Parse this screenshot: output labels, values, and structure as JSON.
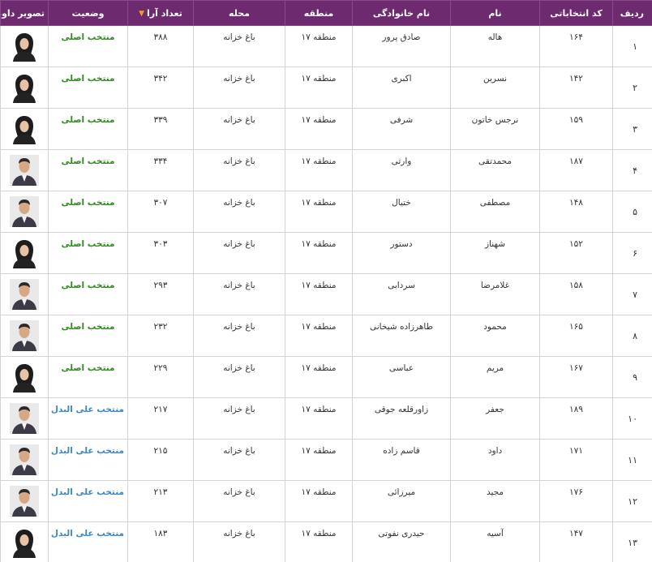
{
  "headers": {
    "row": "ردیف",
    "code": "کد انتخاباتی",
    "first_name": "نام",
    "last_name": "نام خانوادگی",
    "region": "منطقه",
    "area": "محله",
    "votes": "تعداد آرا",
    "status": "وضعیت",
    "photo": "تصویر داوطلب"
  },
  "status_colors": {
    "main": "#2e8b1e",
    "alternate": "#3a88c8"
  },
  "header_color": "#6e2a6e",
  "rows": [
    {
      "row": "۱",
      "code": "۱۶۴",
      "first_name": "هاله",
      "last_name": "صادق پرور",
      "region": "منطقه ۱۷",
      "area": "باغ خزانه",
      "votes": "۳۸۸",
      "status": "منتخب اصلی",
      "kind": "main",
      "photo_icon": "female-avatar-icon"
    },
    {
      "row": "۲",
      "code": "۱۴۲",
      "first_name": "نسرین",
      "last_name": "اکبری",
      "region": "منطقه ۱۷",
      "area": "باغ خزانه",
      "votes": "۳۴۲",
      "status": "منتخب اصلی",
      "kind": "main",
      "photo_icon": "female-avatar-icon"
    },
    {
      "row": "۳",
      "code": "۱۵۹",
      "first_name": "نرجس خاتون",
      "last_name": "شرفی",
      "region": "منطقه ۱۷",
      "area": "باغ خزانه",
      "votes": "۳۳۹",
      "status": "منتخب اصلی",
      "kind": "main",
      "photo_icon": "female-avatar-icon"
    },
    {
      "row": "۴",
      "code": "۱۸۷",
      "first_name": "محمدتقی",
      "last_name": "وارثی",
      "region": "منطقه ۱۷",
      "area": "باغ خزانه",
      "votes": "۳۳۴",
      "status": "منتخب اصلی",
      "kind": "main",
      "photo_icon": "male-avatar-icon"
    },
    {
      "row": "۵",
      "code": "۱۴۸",
      "first_name": "مصطفی",
      "last_name": "ختیال",
      "region": "منطقه ۱۷",
      "area": "باغ خزانه",
      "votes": "۳۰۷",
      "status": "منتخب اصلی",
      "kind": "main",
      "photo_icon": "male-avatar-icon"
    },
    {
      "row": "۶",
      "code": "۱۵۲",
      "first_name": "شهناز",
      "last_name": "دستور",
      "region": "منطقه ۱۷",
      "area": "باغ خزانه",
      "votes": "۳۰۳",
      "status": "منتخب اصلی",
      "kind": "main",
      "photo_icon": "female-avatar-icon"
    },
    {
      "row": "۷",
      "code": "۱۵۸",
      "first_name": "غلامرضا",
      "last_name": "سردابی",
      "region": "منطقه ۱۷",
      "area": "باغ خزانه",
      "votes": "۲۹۳",
      "status": "منتخب اصلی",
      "kind": "main",
      "photo_icon": "male-avatar-icon"
    },
    {
      "row": "۸",
      "code": "۱۶۵",
      "first_name": "محمود",
      "last_name": "طاهرزاده شیخانی",
      "region": "منطقه ۱۷",
      "area": "باغ خزانه",
      "votes": "۲۳۲",
      "status": "منتخب اصلی",
      "kind": "main",
      "photo_icon": "male-avatar-icon"
    },
    {
      "row": "۹",
      "code": "۱۶۷",
      "first_name": "مریم",
      "last_name": "عباسی",
      "region": "منطقه ۱۷",
      "area": "باغ خزانه",
      "votes": "۲۲۹",
      "status": "منتخب اصلی",
      "kind": "main",
      "photo_icon": "female-avatar-icon"
    },
    {
      "row": "۱۰",
      "code": "۱۸۹",
      "first_name": "جعفر",
      "last_name": "زاورقلعه جوقی",
      "region": "منطقه ۱۷",
      "area": "باغ خزانه",
      "votes": "۲۱۷",
      "status": "منتخب علی البدل",
      "kind": "alternate",
      "photo_icon": "male-avatar-icon"
    },
    {
      "row": "۱۱",
      "code": "۱۷۱",
      "first_name": "داود",
      "last_name": "قاسم زاده",
      "region": "منطقه ۱۷",
      "area": "باغ خزانه",
      "votes": "۲۱۵",
      "status": "منتخب علی البدل",
      "kind": "alternate",
      "photo_icon": "male-avatar-icon"
    },
    {
      "row": "۱۲",
      "code": "۱۷۶",
      "first_name": "مجید",
      "last_name": "میرزائی",
      "region": "منطقه ۱۷",
      "area": "باغ خزانه",
      "votes": "۲۱۳",
      "status": "منتخب علی البدل",
      "kind": "alternate",
      "photo_icon": "male-avatar-icon"
    },
    {
      "row": "۱۳",
      "code": "۱۴۷",
      "first_name": "آسیه",
      "last_name": "حیدری نفوتی",
      "region": "منطقه ۱۷",
      "area": "باغ خزانه",
      "votes": "۱۸۳",
      "status": "منتخب علی البدل",
      "kind": "alternate",
      "photo_icon": "female-avatar-icon"
    }
  ]
}
